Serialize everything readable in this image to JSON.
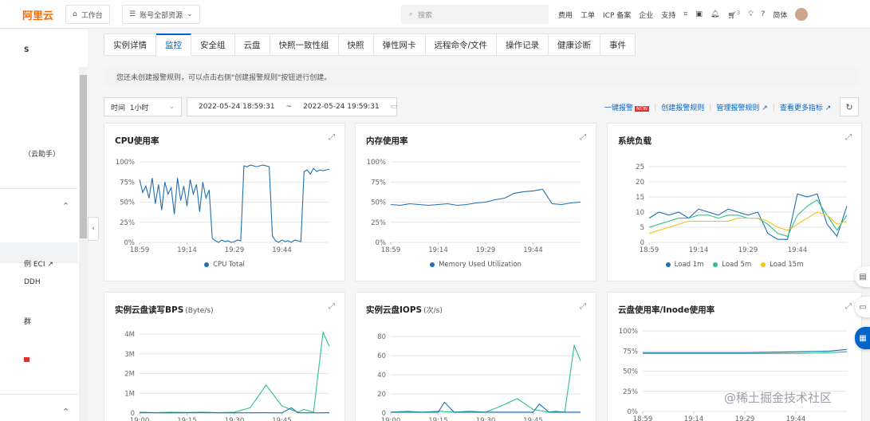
{
  "brand": {
    "logo": "阿里云",
    "accent": "#ff6a00"
  },
  "topbar": {
    "workbench": "工作台",
    "resource_scope": "账号全部资源",
    "search_placeholder": "搜索",
    "menu": [
      "费用",
      "工单",
      "ICP 备案",
      "企业",
      "支持"
    ],
    "cart_count": "3",
    "language": "简体"
  },
  "sidebar": {
    "s_label": "S",
    "assistant": "（云助手）",
    "eci_link": "例 ECI",
    "ddh": "DDH",
    "group": "群",
    "icons": [
      "chevron-up-icon",
      "external-link-icon",
      "chevron-up-icon"
    ]
  },
  "tabs": [
    "实例详情",
    "监控",
    "安全组",
    "云盘",
    "快照一致性组",
    "快照",
    "弹性网卡",
    "远程命令/文件",
    "操作记录",
    "健康诊断",
    "事件"
  ],
  "active_tab": "监控",
  "notice": "您还未创建报警规则，可以点击右侧\"创建报警规则\"按钮进行创建。",
  "filter": {
    "time_label": "时间",
    "time_value": "1小时",
    "start": "2022-05-24 18:59:31",
    "separator": "~",
    "end": "2022-05-24 19:59:31"
  },
  "actions": {
    "one_click_alarm": "一键报警",
    "new_badge": "NEW",
    "create_rule": "创建报警规则",
    "manage_rules": "管理报警规则",
    "view_more": "查看更多指标"
  },
  "colors": {
    "primary": "#0064c8",
    "series_blue": "#1f6fb5",
    "series_green": "#2bc18e",
    "series_yellow": "#f5c518"
  },
  "charts": [
    {
      "id": "cpu",
      "title": "CPU使用率",
      "unit": "",
      "yticks": [
        "100%",
        "75%",
        "50%",
        "25%",
        "0%"
      ],
      "xticks": [
        "18:59",
        "19:14",
        "19:29",
        "19:44"
      ],
      "legend": [
        {
          "name": "CPU Total",
          "color": "#1f6fb5"
        }
      ]
    },
    {
      "id": "mem",
      "title": "内存使用率",
      "unit": "",
      "yticks": [
        "100%",
        "75%",
        "50%",
        "25%",
        "0%"
      ],
      "xticks": [
        "18:59",
        "19:14",
        "19:29",
        "19:44"
      ],
      "legend": [
        {
          "name": "Memory Used Utilization",
          "color": "#1f6fb5"
        }
      ]
    },
    {
      "id": "load",
      "title": "系统负载",
      "unit": "",
      "yticks": [
        "25",
        "20",
        "15",
        "10",
        "5",
        "0"
      ],
      "xticks": [
        "18:59",
        "19:14",
        "19:29",
        "19:44"
      ],
      "legend": [
        {
          "name": "Load 1m",
          "color": "#1f6fb5"
        },
        {
          "name": "Load 5m",
          "color": "#2bc18e"
        },
        {
          "name": "Load 15m",
          "color": "#f5c518"
        }
      ]
    },
    {
      "id": "bps",
      "title": "实例云盘读写BPS",
      "unit": "(Byte/s)",
      "yticks": [
        "4M",
        "3M",
        "2M",
        "1M",
        "0"
      ],
      "xticks": [
        "19:00",
        "19:15",
        "19:30",
        "19:45"
      ]
    },
    {
      "id": "iops",
      "title": "实例云盘IOPS",
      "unit": "(次/s)",
      "yticks": [
        "80",
        "60",
        "40",
        "20",
        "0"
      ],
      "xticks": [
        "19:00",
        "19:15",
        "19:30",
        "19:45"
      ]
    },
    {
      "id": "disk",
      "title": "云盘使用率/Inode使用率",
      "unit": "",
      "yticks": [
        "100%",
        "75%",
        "50%",
        "25%",
        "0%"
      ],
      "xticks": [
        "18:59",
        "19:14",
        "19:29",
        "19:44"
      ]
    }
  ],
  "chart_data": [
    {
      "type": "line",
      "title": "CPU使用率",
      "x_range": [
        "18:59",
        "19:59"
      ],
      "ylim": [
        0,
        100
      ],
      "series": [
        {
          "name": "CPU Total",
          "x": [
            0,
            1,
            2,
            3,
            4,
            5,
            6,
            7,
            8,
            9,
            10,
            11,
            12,
            13,
            14,
            15,
            16,
            17,
            18,
            19,
            20,
            21,
            22,
            23,
            24,
            25,
            26,
            27,
            28,
            29,
            30,
            31,
            32,
            33,
            34,
            35,
            36,
            37,
            38,
            39,
            40,
            41,
            42,
            43,
            44,
            45,
            46,
            47,
            48,
            49,
            50,
            51,
            52,
            53,
            54,
            55,
            56,
            57,
            58,
            59,
            60
          ],
          "values": [
            78,
            62,
            70,
            55,
            80,
            48,
            72,
            40,
            75,
            60,
            68,
            35,
            80,
            52,
            70,
            45,
            78,
            60,
            72,
            38,
            75,
            55,
            65,
            5,
            2,
            0,
            3,
            1,
            2,
            0,
            1,
            3,
            2,
            95,
            94,
            96,
            95,
            94,
            95,
            96,
            95,
            94,
            8,
            2,
            0,
            3,
            1,
            2,
            0,
            3,
            2,
            1,
            88,
            90,
            85,
            92,
            88,
            90,
            89,
            90,
            91
          ]
        }
      ]
    },
    {
      "type": "line",
      "title": "内存使用率",
      "x_range": [
        "18:59",
        "19:59"
      ],
      "ylim": [
        0,
        100
      ],
      "series": [
        {
          "name": "Memory Used Utilization",
          "x": [
            0,
            3,
            6,
            9,
            12,
            15,
            18,
            21,
            24,
            27,
            30,
            33,
            36,
            39,
            42,
            45,
            48,
            51,
            54,
            57,
            60
          ],
          "values": [
            47,
            46,
            48,
            47,
            46,
            47,
            48,
            46,
            47,
            49,
            50,
            53,
            55,
            61,
            63,
            64,
            66,
            48,
            47,
            49,
            50
          ]
        }
      ]
    },
    {
      "type": "line",
      "title": "系统负载",
      "x_range": [
        "18:59",
        "19:59"
      ],
      "ylim": [
        0,
        25
      ],
      "series": [
        {
          "name": "Load 1m",
          "x": [
            0,
            3,
            6,
            9,
            12,
            15,
            18,
            21,
            24,
            27,
            30,
            33,
            36,
            39,
            42,
            45,
            48,
            51,
            54,
            57,
            60
          ],
          "values": [
            8,
            10,
            9,
            10,
            8,
            11,
            10,
            9,
            11,
            10,
            9,
            10,
            3,
            1,
            1,
            16,
            15,
            16,
            6,
            2,
            12
          ]
        },
        {
          "name": "Load 5m",
          "x": [
            0,
            3,
            6,
            9,
            12,
            15,
            18,
            21,
            24,
            27,
            30,
            33,
            36,
            39,
            42,
            45,
            48,
            51,
            54,
            57,
            60
          ],
          "values": [
            5,
            6,
            7,
            8,
            8,
            9,
            9,
            8,
            9,
            9,
            8,
            8,
            6,
            3,
            2,
            9,
            12,
            14,
            9,
            4,
            9
          ]
        },
        {
          "name": "Load 15m",
          "x": [
            0,
            3,
            6,
            9,
            12,
            15,
            18,
            21,
            24,
            27,
            30,
            33,
            36,
            39,
            42,
            45,
            48,
            51,
            54,
            57,
            60
          ],
          "values": [
            3,
            4,
            5,
            6,
            7,
            7,
            7,
            7,
            7,
            8,
            8,
            8,
            7,
            5,
            4,
            6,
            8,
            10,
            9,
            6,
            7
          ]
        }
      ]
    },
    {
      "type": "line",
      "title": "实例云盘读写BPS",
      "x_range": [
        "19:00",
        "19:59"
      ],
      "ylim": [
        0,
        4.5
      ],
      "series": [
        {
          "x": [
            0,
            5,
            10,
            15,
            20,
            25,
            30,
            35,
            40,
            45,
            50,
            52,
            55,
            58,
            60
          ],
          "values": [
            0.05,
            0.02,
            0.05,
            0.03,
            0.05,
            0.02,
            0.05,
            0.3,
            1.6,
            0.4,
            0.05,
            0.2,
            0.05,
            4.6,
            3.8
          ]
        },
        {
          "x": [
            0,
            10,
            20,
            30,
            40,
            45,
            48,
            50,
            55,
            60
          ],
          "values": [
            0.02,
            0.01,
            0.02,
            0.01,
            0.02,
            0.01,
            0.3,
            0.02,
            0.01,
            0.02
          ]
        }
      ]
    },
    {
      "type": "line",
      "title": "实例云盘IOPS",
      "x_range": [
        "19:00",
        "19:59"
      ],
      "ylim": [
        0,
        85
      ],
      "series": [
        {
          "x": [
            0,
            5,
            10,
            15,
            20,
            25,
            30,
            35,
            40,
            45,
            50,
            52,
            55,
            58,
            60
          ],
          "values": [
            1,
            2,
            1,
            2,
            1,
            2,
            1,
            8,
            16,
            4,
            1,
            2,
            1,
            75,
            58
          ]
        },
        {
          "x": [
            0,
            10,
            15,
            17,
            20,
            30,
            40,
            45,
            47,
            50,
            60
          ],
          "values": [
            1,
            1,
            1,
            12,
            1,
            1,
            1,
            1,
            10,
            1,
            1
          ]
        }
      ]
    },
    {
      "type": "line",
      "title": "云盘使用率/Inode使用率",
      "x_range": [
        "18:59",
        "19:59"
      ],
      "ylim": [
        0,
        100
      ],
      "series": [
        {
          "x": [
            0,
            15,
            30,
            45,
            55,
            60
          ],
          "values": [
            73,
            73,
            73,
            74,
            75,
            77
          ]
        },
        {
          "x": [
            0,
            15,
            30,
            45,
            55,
            60
          ],
          "values": [
            72,
            72,
            72,
            72,
            73,
            74
          ]
        }
      ]
    }
  ]
}
